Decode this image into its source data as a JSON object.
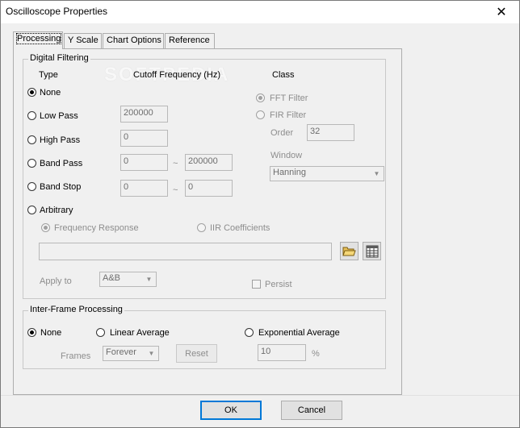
{
  "window": {
    "title": "Oscilloscope Properties",
    "close_glyph": "✕"
  },
  "tabs": [
    {
      "label": "Processing",
      "active": true
    },
    {
      "label": "Y Scale"
    },
    {
      "label": "Chart Options"
    },
    {
      "label": "Reference"
    }
  ],
  "watermark": "SOFTPEDIA",
  "digital_filtering": {
    "title": "Digital Filtering",
    "headers": {
      "type": "Type",
      "cutoff": "Cutoff Frequency (Hz)",
      "class": "Class"
    },
    "filters": {
      "none": {
        "label": "None"
      },
      "low_pass": {
        "label": "Low Pass",
        "value": "200000"
      },
      "high_pass": {
        "label": "High Pass",
        "value": "0"
      },
      "band_pass": {
        "label": "Band Pass",
        "low": "0",
        "sep": "~",
        "high": "200000"
      },
      "band_stop": {
        "label": "Band Stop",
        "low": "0",
        "sep": "~",
        "high": "0"
      },
      "arbitrary": {
        "label": "Arbitrary"
      }
    },
    "arbitrary": {
      "freq_response": "Frequency Response",
      "iir_coefficients": "IIR Coefficients",
      "path_value": ""
    },
    "class": {
      "fft": "FFT Filter",
      "fir": "FIR Filter",
      "order_label": "Order",
      "order_value": "32",
      "window_label": "Window",
      "window_value": "Hanning"
    },
    "apply_to_label": "Apply to",
    "apply_to_value": "A&B",
    "persist_label": "Persist"
  },
  "inter_frame": {
    "title": "Inter-Frame Processing",
    "none": "None",
    "linear": "Linear Average",
    "exponential": "Exponential Average",
    "frames_label": "Frames",
    "frames_value": "Forever",
    "reset_label": "Reset",
    "exp_value": "10",
    "percent": "%"
  },
  "buttons": {
    "ok": "OK",
    "cancel": "Cancel"
  },
  "colors": {
    "focus_border": "#0078d7",
    "disabled_text": "#8d8d8d"
  }
}
